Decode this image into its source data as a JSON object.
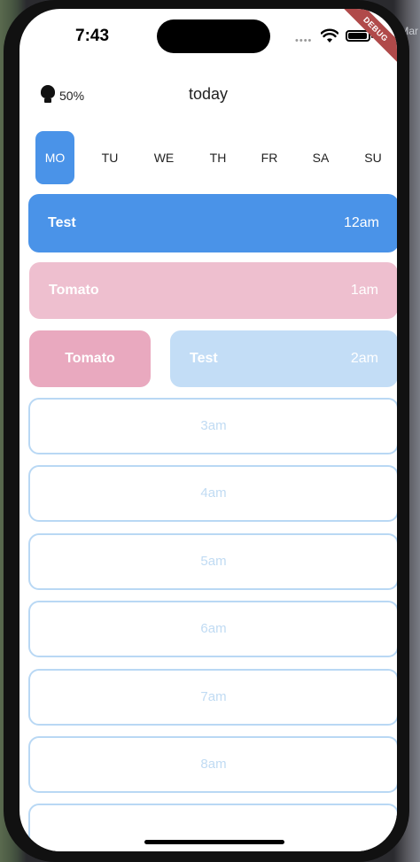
{
  "overlay": {
    "corner_text": "-Mar"
  },
  "status_bar": {
    "time": "7:43",
    "signal": "••••"
  },
  "debug_banner": "DEBUG",
  "header": {
    "brightness": "50%",
    "title": "today"
  },
  "days": [
    {
      "label": "MO",
      "active": true
    },
    {
      "label": "TU",
      "active": false
    },
    {
      "label": "WE",
      "active": false
    },
    {
      "label": "TH",
      "active": false
    },
    {
      "label": "FR",
      "active": false
    },
    {
      "label": "SA",
      "active": false
    },
    {
      "label": "SU",
      "active": false
    }
  ],
  "schedule": {
    "row_12am": {
      "name": "Test",
      "time": "12am"
    },
    "row_1am": {
      "name": "Tomato",
      "time": "1am"
    },
    "row_2am": {
      "left_name": "Tomato",
      "right_name": "Test",
      "time": "2am"
    },
    "empty": [
      "3am",
      "4am",
      "5am",
      "6am",
      "7am",
      "8am"
    ]
  },
  "colors": {
    "blue": "#4a93e8",
    "pink_light": "#eebfcf",
    "pink": "#e9a9bf",
    "blue_light": "#c3ddf6",
    "outline": "#b9d8f4"
  }
}
